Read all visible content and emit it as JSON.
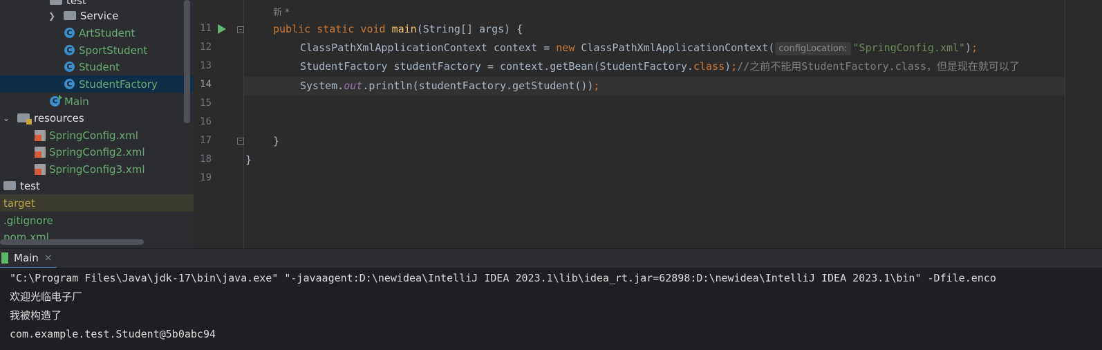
{
  "project_tree": {
    "partial_top_label": "test",
    "items": [
      {
        "label": "Service",
        "type": "folder",
        "color": "#dfe1e5"
      },
      {
        "label": "ArtStudent",
        "type": "class",
        "color": "#6aab73"
      },
      {
        "label": "SportStudent",
        "type": "class",
        "color": "#6aab73"
      },
      {
        "label": "Student",
        "type": "class",
        "color": "#6aab73"
      },
      {
        "label": "StudentFactory",
        "type": "class",
        "color": "#6aab73"
      },
      {
        "label": "Main",
        "type": "main-class",
        "color": "#6aab73"
      },
      {
        "label": "resources",
        "type": "resources-folder",
        "color": "#dfe1e5"
      },
      {
        "label": "SpringConfig.xml",
        "type": "xml",
        "color": "#6aab73"
      },
      {
        "label": "SpringConfig2.xml",
        "type": "xml",
        "color": "#6aab73"
      },
      {
        "label": "SpringConfig3.xml",
        "type": "xml",
        "color": "#6aab73"
      },
      {
        "label": "test",
        "type": "folder",
        "color": "#dfe1e5"
      },
      {
        "label": "target",
        "type": "excluded",
        "color": "#b8a94a"
      },
      {
        "label": ".gitignore",
        "type": "file",
        "color": "#6aab73"
      },
      {
        "label": "pom.xml",
        "type": "file",
        "color": "#6aab73"
      }
    ]
  },
  "editor": {
    "author_hint": "新 *",
    "line_numbers": [
      "11",
      "12",
      "13",
      "14",
      "15",
      "16",
      "17",
      "18",
      "19"
    ],
    "active_line": "14",
    "param_hint": "configLocation:",
    "code": {
      "l11_kw": "public static void ",
      "l11_fn": "main",
      "l11_rest": "(String[] args) {",
      "l12_a": "ClassPathXmlApplicationContext context = ",
      "l12_kw": "new ",
      "l12_b": "ClassPathXmlApplicationContext(",
      "l12_str": "\"SpringConfig.xml\"",
      "l12_c": ")",
      "l12_semi": ";",
      "l13_a": "StudentFactory studentFactory = context.getBean(StudentFactory.",
      "l13_kw": "class",
      "l13_b": ")",
      "l13_semi": ";",
      "l13_cmt": "//之前不能用StudentFactory.class，但是现在就可以了",
      "l14_a": "System.",
      "l14_field": "out",
      "l14_b": ".println(studentFactory.getStudent())",
      "l14_semi": ";",
      "l17": "}",
      "l18": "}"
    }
  },
  "run_panel": {
    "tab_label": "Main",
    "close_glyph": "×",
    "output": [
      "\"C:\\Program Files\\Java\\jdk-17\\bin\\java.exe\" \"-javaagent:D:\\newidea\\IntelliJ IDEA 2023.1\\lib\\idea_rt.jar=62898:D:\\newidea\\IntelliJ IDEA 2023.1\\bin\" -Dfile.enco",
      "欢迎光临电子厂",
      "我被构造了",
      "com.example.test.Student@5b0abc94"
    ]
  }
}
